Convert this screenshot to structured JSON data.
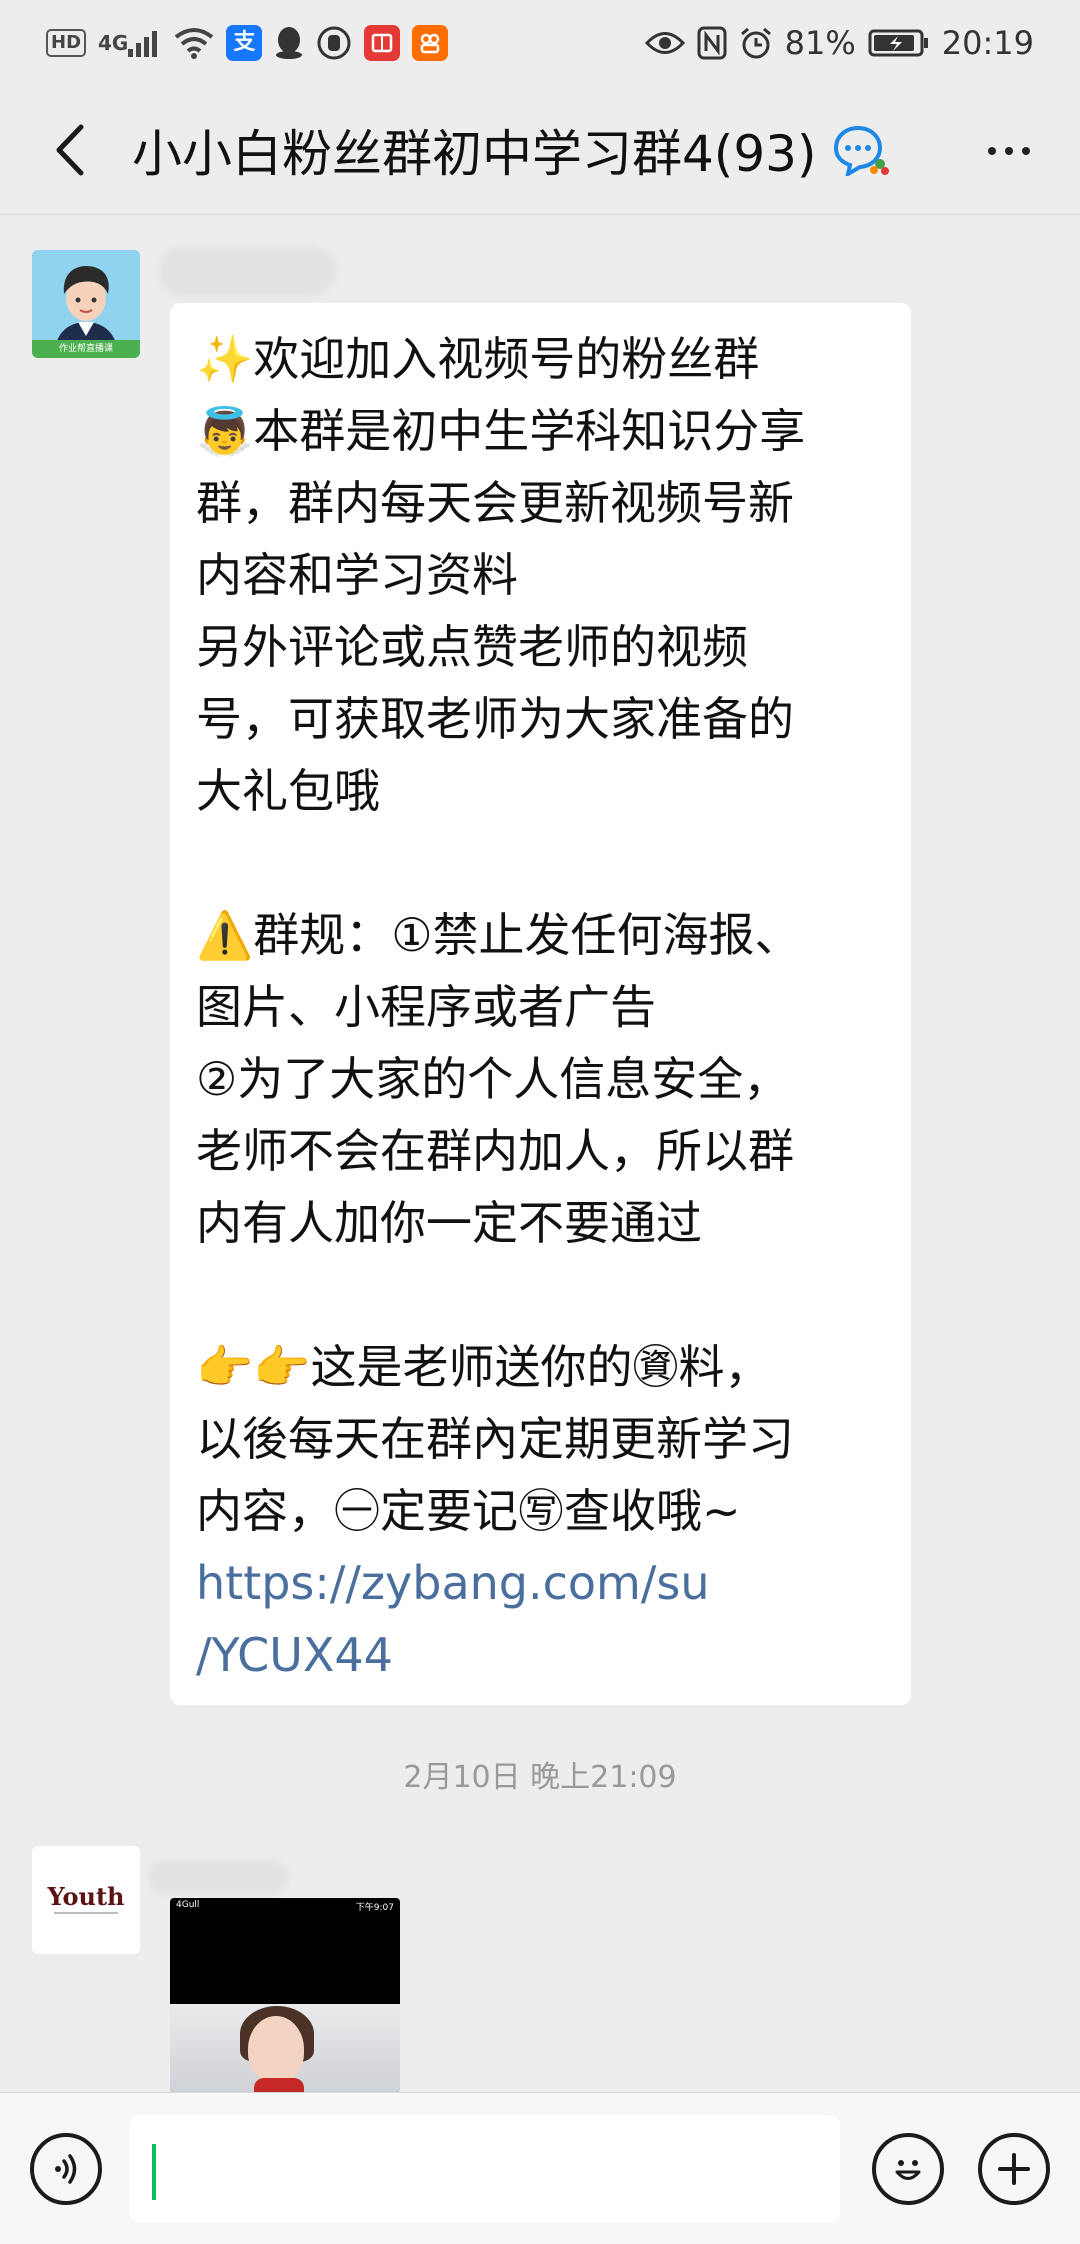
{
  "status_bar": {
    "hd": "HD",
    "signal": "4G",
    "battery": "81%",
    "time": "20:19",
    "icons": [
      "hd-icon",
      "signal-icon",
      "wifi-icon",
      "alipay-icon",
      "qq-icon",
      "hand-icon",
      "red-book-icon",
      "orange-app-icon",
      "eye-icon",
      "nfc-icon",
      "alarm-icon",
      "battery-icon"
    ],
    "alipay_char": "支",
    "colors": {
      "alipay": "#1677ff",
      "red_app": "#e53935",
      "orange_app": "#ff6d00"
    }
  },
  "header": {
    "title": "小小白粉丝群初中学习群4(93)"
  },
  "messages": {
    "first": {
      "avatar_badge": "作业帮直播课",
      "lines": [
        "✨欢迎加入视频号的粉丝群",
        "👼本群是初中生学科知识分享",
        "群，群内每天会更新视频号新",
        "内容和学习资料",
        "另外评论或点赞老师的视频",
        "号，可获取老师为大家准备的",
        "大礼包哦",
        "",
        "⚠️群规：①禁止发任何海报、",
        "图片、小程序或者广告",
        "②为了大家的个人信息安全，",
        "老师不会在群内加人，所以群",
        "内有人加你一定不要通过",
        "",
        "👉👉这是老师送你的㊮料，",
        "以後每天在群內定期更新学习",
        "内容，㊀定要记㊢查收哦~"
      ],
      "link_lines": [
        "https://zybang.com/su",
        "/YCUX44"
      ]
    },
    "timestamp": "2月10日 晚上21:09",
    "second": {
      "avatar_text": "Youth",
      "image_status_left": "4Gull",
      "image_status_time": "下午9:07"
    }
  },
  "input": {
    "value": ""
  }
}
